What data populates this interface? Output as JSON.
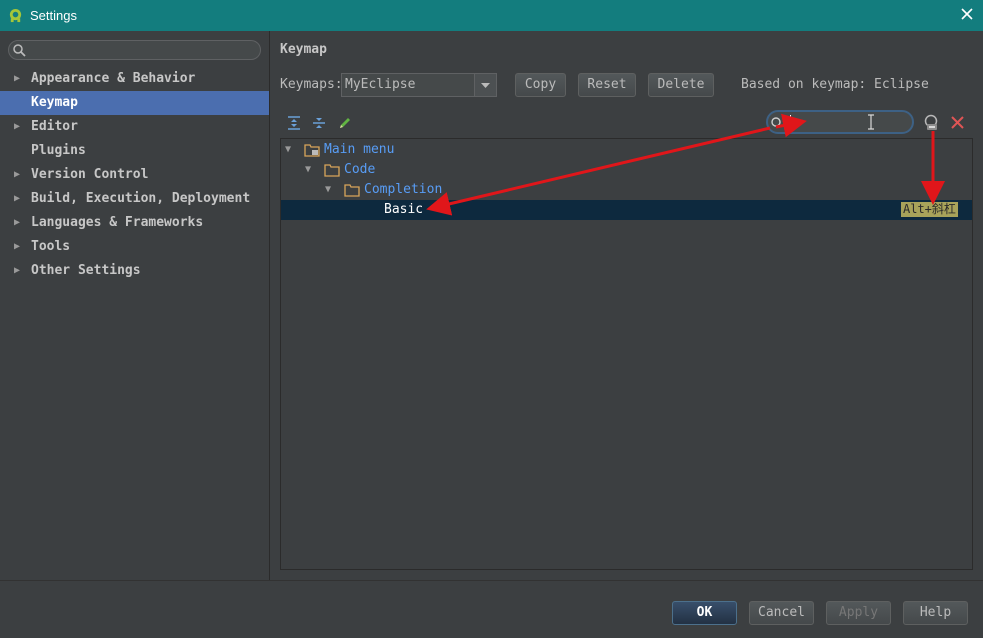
{
  "window": {
    "title": "Settings",
    "app_icon": "android-icon",
    "close_icon": "close-icon"
  },
  "search": {
    "placeholder": "",
    "icon": "search-icon"
  },
  "sidebar": {
    "items": [
      {
        "label": "Appearance & Behavior",
        "expandable": true
      },
      {
        "label": "Keymap",
        "expandable": false,
        "selected": true
      },
      {
        "label": "Editor",
        "expandable": true
      },
      {
        "label": "Plugins",
        "expandable": false
      },
      {
        "label": "Version Control",
        "expandable": true
      },
      {
        "label": "Build, Execution, Deployment",
        "expandable": true
      },
      {
        "label": "Languages & Frameworks",
        "expandable": true
      },
      {
        "label": "Tools",
        "expandable": true
      },
      {
        "label": "Other Settings",
        "expandable": true
      }
    ]
  },
  "keymap": {
    "title": "Keymap",
    "keymaps_label": "Keymaps:",
    "selected_keymap": "MyEclipse",
    "copy_label": "Copy",
    "reset_label": "Reset",
    "delete_label": "Delete",
    "based_on": "Based on keymap: Eclipse",
    "filter_value": ""
  },
  "tree": [
    {
      "label": "Main menu",
      "level": 0,
      "expanded": true
    },
    {
      "label": "Code",
      "level": 1,
      "expanded": true
    },
    {
      "label": "Completion",
      "level": 2,
      "expanded": true
    },
    {
      "label": "Basic",
      "level": 3,
      "shortcut": "Alt+斜杠",
      "selected": true
    }
  ],
  "buttons": {
    "ok": "OK",
    "cancel": "Cancel",
    "apply": "Apply",
    "help": "Help"
  },
  "colors": {
    "accent": "#4b6eaf",
    "titlebar": "#137d7e",
    "annotation": "#e0161a",
    "link": "#589df6"
  }
}
